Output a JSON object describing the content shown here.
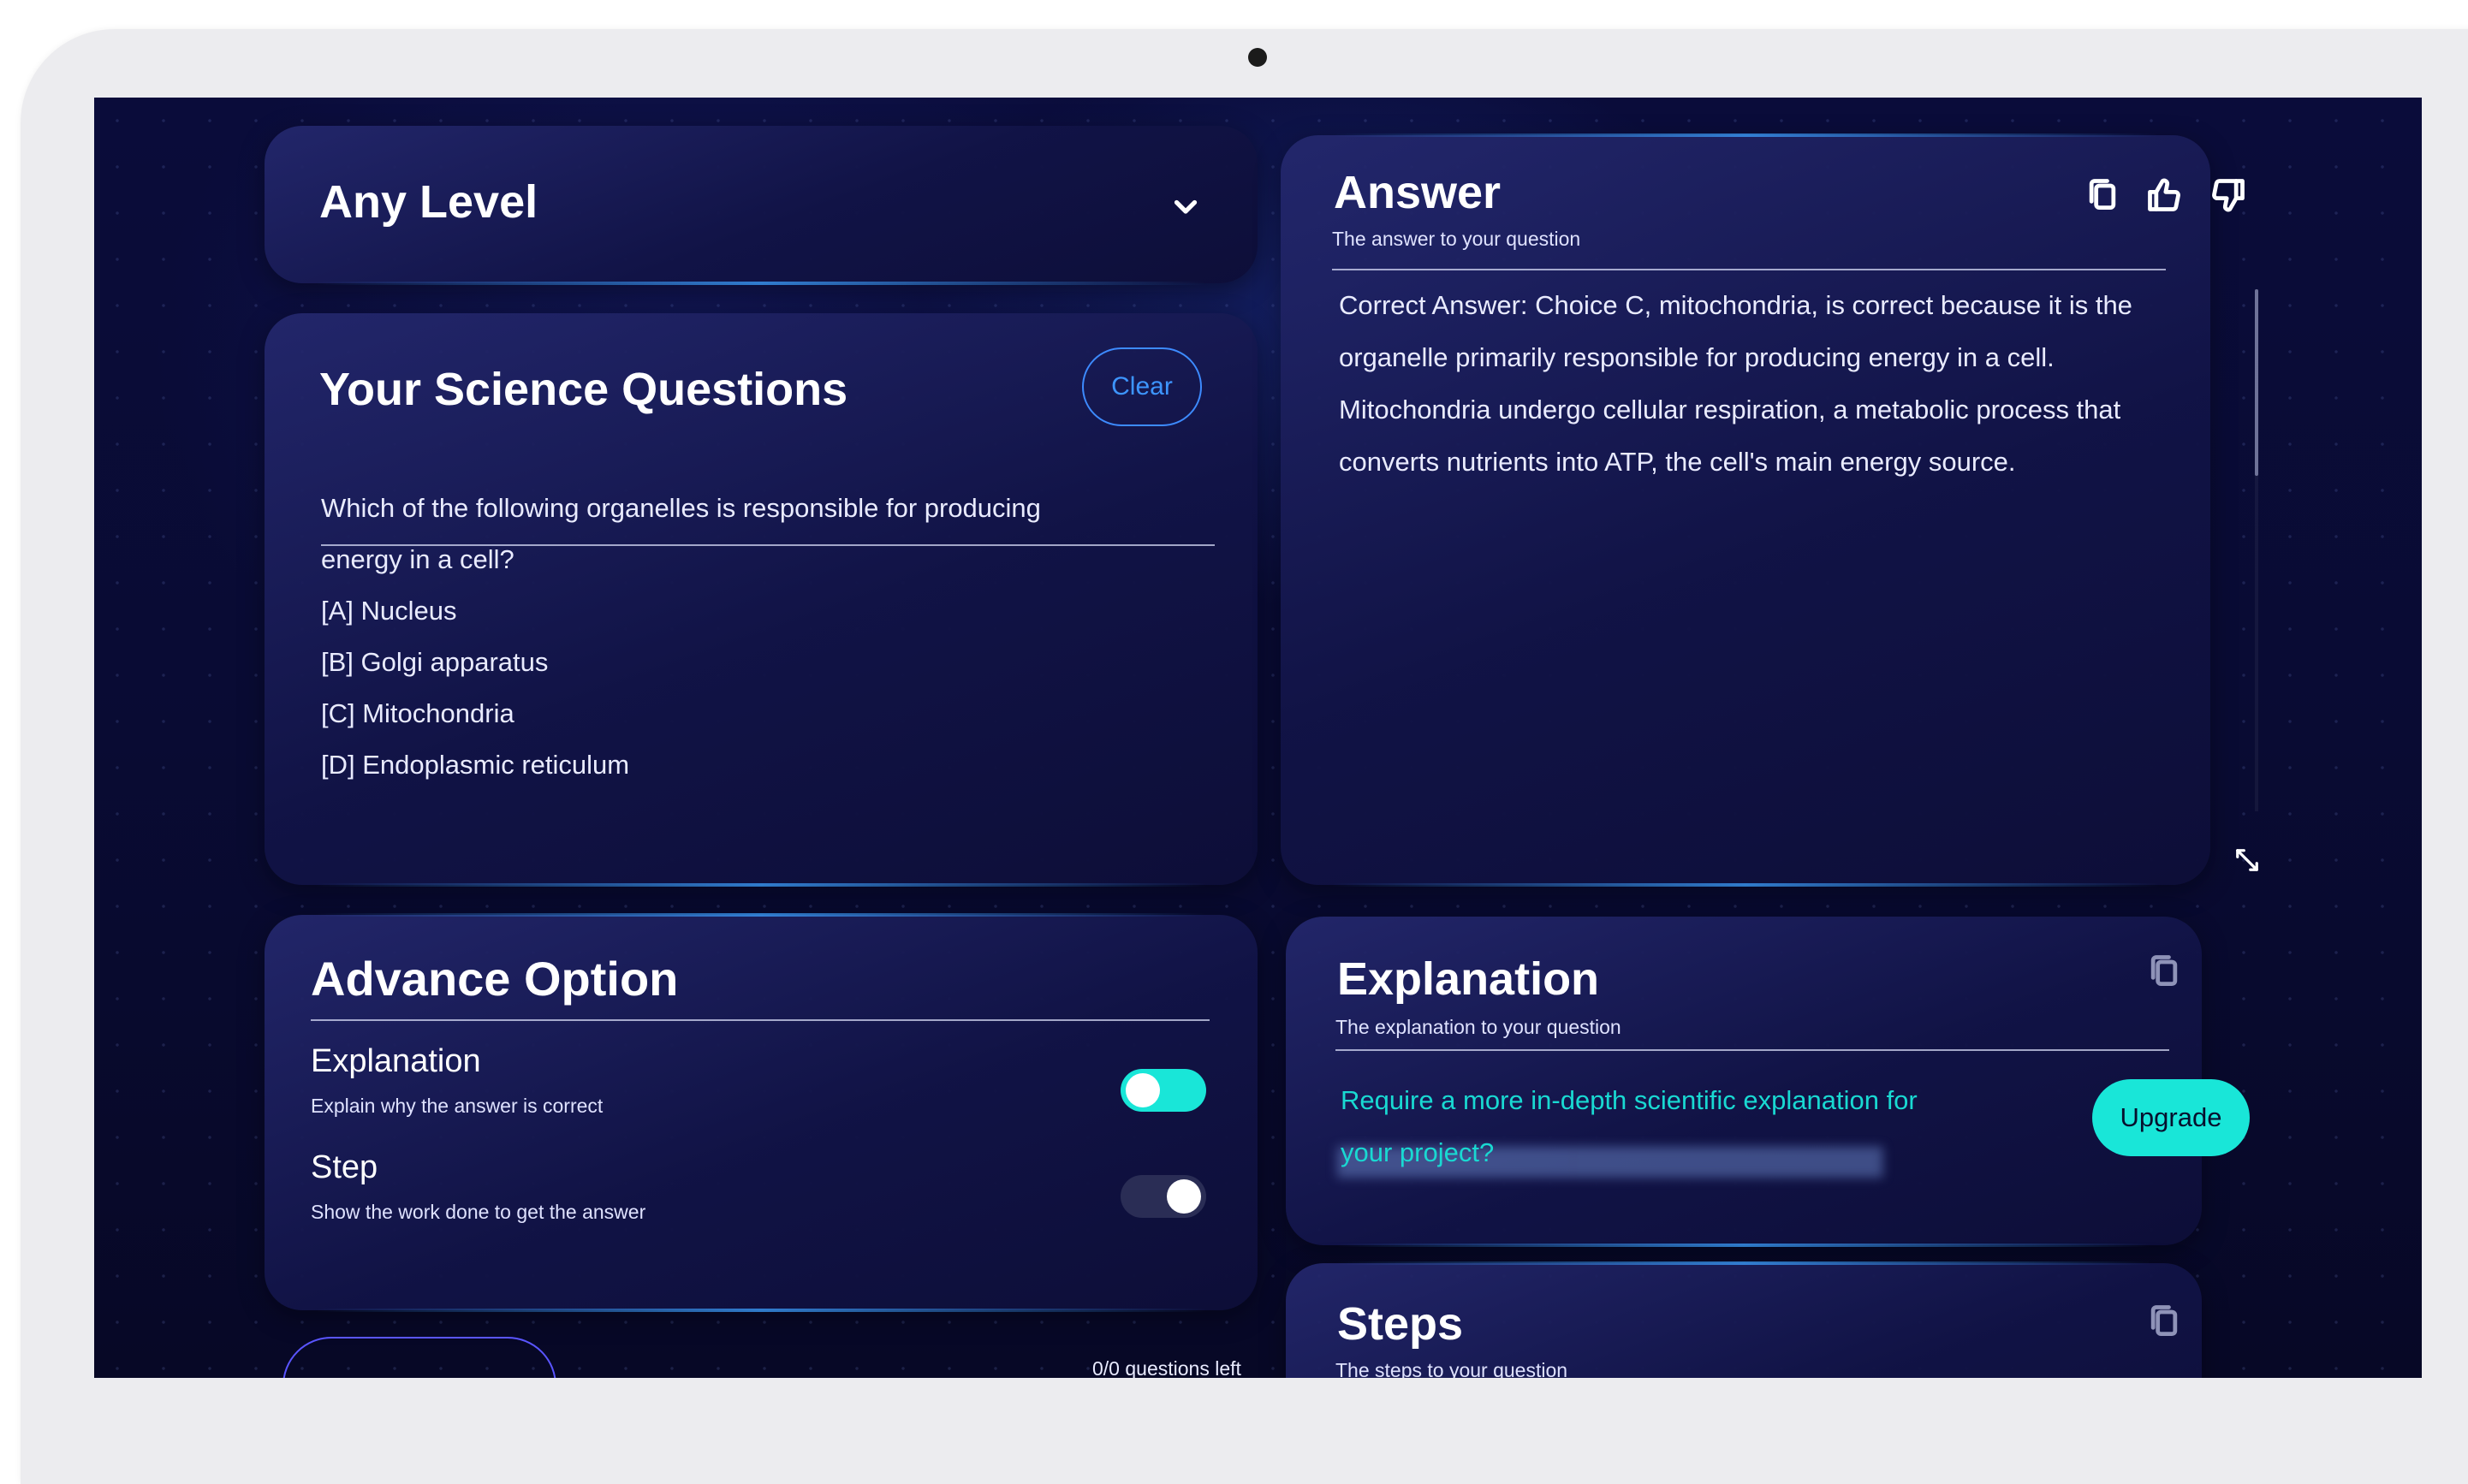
{
  "level_selector": {
    "value": "Any Level"
  },
  "questions": {
    "title": "Your Science Questions",
    "clear_label": "Clear",
    "question": "Which of the following organelles is responsible for producing energy in a cell?",
    "options": [
      "[A]  Nucleus",
      "[B] Golgi apparatus",
      "[C] Mitochondria",
      "[D] Endoplasmic reticulum"
    ]
  },
  "advance": {
    "title": "Advance Option",
    "options": [
      {
        "label": "Explanation",
        "description": "Explain why the answer is correct",
        "enabled": true
      },
      {
        "label": "Step",
        "description": "Show the work done to get the answer",
        "enabled": false
      }
    ],
    "questions_left": "0/0 questions left"
  },
  "answer": {
    "title": "Answer",
    "subtitle": "The answer to your question",
    "text": "Correct Answer: Choice C, mitochondria, is correct because it is the organelle primarily responsible for producing energy in a cell. Mitochondria undergo cellular respiration, a metabolic process that converts nutrients into ATP, the cell's main energy source."
  },
  "explanation": {
    "title": "Explanation",
    "subtitle": "The explanation to your question",
    "prompt": "Require a more in-depth scientific explanation for your project?",
    "upgrade_label": "Upgrade"
  },
  "steps": {
    "title": "Steps",
    "subtitle": "The steps to your question"
  },
  "colors": {
    "accent": "#19e6d8",
    "link_blue": "#3d95ff",
    "background": "#0a0c3a"
  },
  "icons": [
    "chevron-down-icon",
    "copy-icon",
    "thumbs-up-icon",
    "thumbs-down-icon",
    "expand-icon"
  ]
}
